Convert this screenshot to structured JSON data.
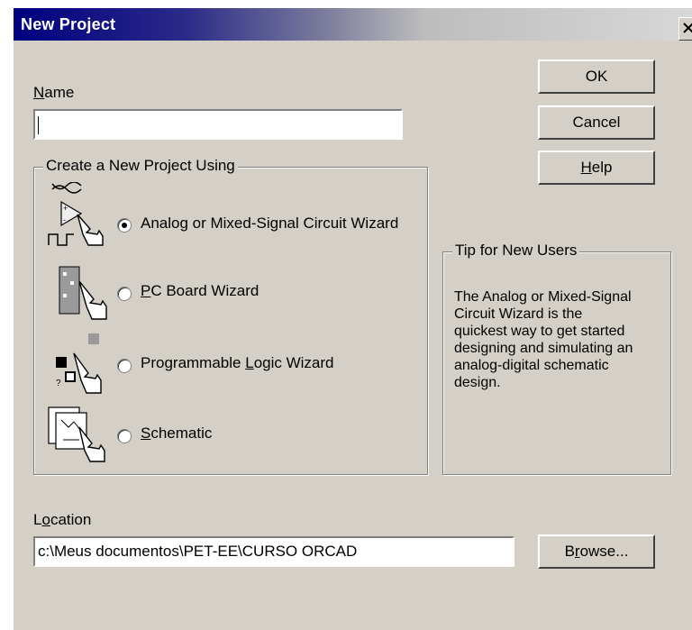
{
  "window": {
    "title": "New Project"
  },
  "name_field": {
    "label_underlined": "N",
    "label_rest": "ame",
    "value": ""
  },
  "buttons": {
    "ok": "OK",
    "cancel": "Cancel",
    "help_underlined": "H",
    "help_rest": "elp",
    "browse_before": "B",
    "browse_underlined": "r",
    "browse_after": "owse..."
  },
  "create_group": {
    "legend": "Create a New Project Using",
    "options": [
      {
        "label_before": "Analog or Mixed-Signal Circuit Wizard",
        "label_underlined": "",
        "label_after": "",
        "selected": true,
        "icon": "analog-wizard-icon"
      },
      {
        "label_before": "",
        "label_underlined": "P",
        "label_after": "C Board Wizard",
        "selected": false,
        "icon": "pcb-wizard-icon"
      },
      {
        "label_before": "Programmable ",
        "label_underlined": "L",
        "label_after": "ogic Wizard",
        "selected": false,
        "icon": "logic-wizard-icon"
      },
      {
        "label_before": "",
        "label_underlined": "S",
        "label_after": "chematic",
        "selected": false,
        "icon": "schematic-icon"
      }
    ]
  },
  "tip": {
    "legend": "Tip for New Users",
    "lines": [
      "The Analog or Mixed-Signal",
      "Circuit Wizard is the",
      "quickest way to get started",
      "designing and simulating an",
      "analog-digital schematic",
      "design."
    ]
  },
  "location": {
    "label_before": "L",
    "label_underlined": "o",
    "label_after": "cation",
    "value": "c:\\Meus documentos\\PET-EE\\CURSO ORCAD"
  }
}
